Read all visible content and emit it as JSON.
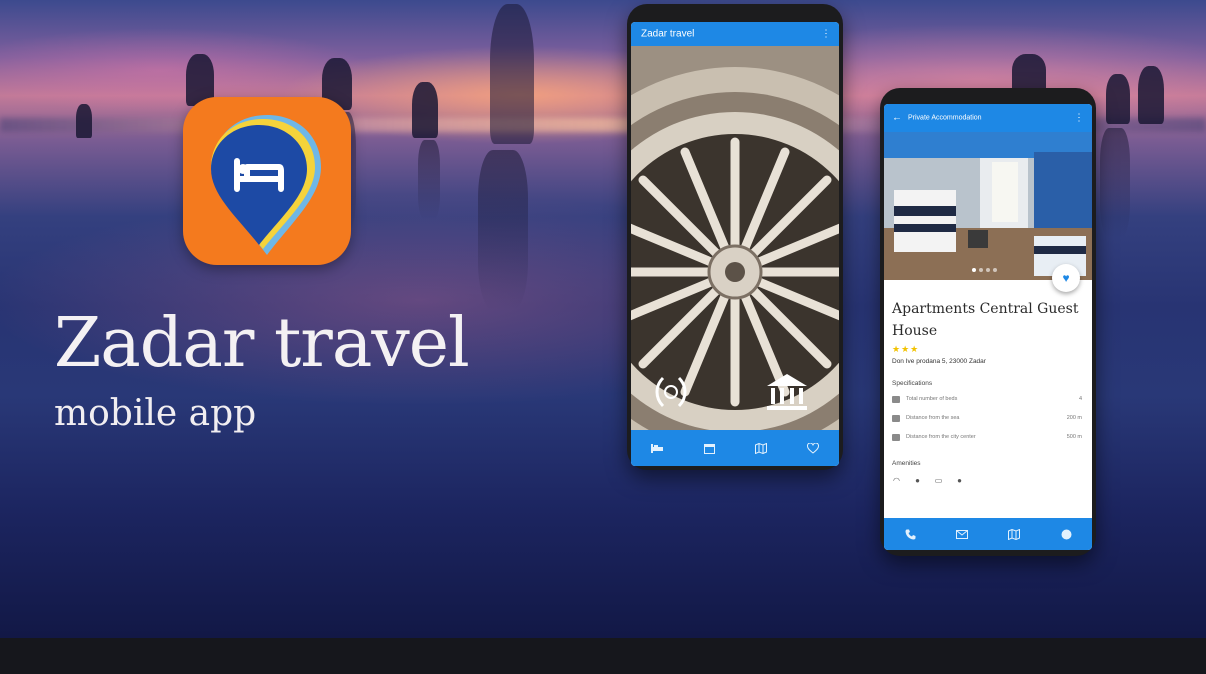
{
  "hero": {
    "title": "Zadar travel",
    "subtitle": "mobile app"
  },
  "app_icon": {
    "name": "bed-location-pin-icon",
    "background": "#f47a1e",
    "pin_colors": [
      "#1d4aa5",
      "#f5d33b",
      "#6fb7e6"
    ]
  },
  "phone1": {
    "appbar_title": "Zadar travel",
    "menu_icon": "more-vert-icon",
    "image": "rose-window-stone-carving",
    "overlay_icons": [
      "laurel-wreath-icon",
      "museum-icon"
    ],
    "nav_icons": [
      "bed-icon",
      "calendar-icon",
      "map-icon",
      "heart-icon"
    ]
  },
  "phone2": {
    "appbar_title": "Private Accommodation",
    "back_icon": "arrow-back-icon",
    "menu_icon": "more-vert-icon",
    "image": "apartment-bedroom-photo",
    "fav_icon": "heart-outline-icon",
    "hotel_name": "Apartments Central Guest House",
    "stars": "★★★",
    "rating": 3,
    "address": "Don Ive prodana 5, 23000 Zadar",
    "specs_label": "Specifications",
    "specs": [
      {
        "label": "Total number of beds",
        "value": "4"
      },
      {
        "label": "Distance from the sea",
        "value": "200 m"
      },
      {
        "label": "Distance from the city center",
        "value": "500 m"
      }
    ],
    "amenities_label": "Amenities",
    "amenity_icons": [
      "wifi-icon",
      "parking-icon",
      "tv-icon",
      "air-conditioning-icon"
    ],
    "nav_icons": [
      "phone-icon",
      "email-icon",
      "map-icon",
      "globe-icon"
    ]
  },
  "colors": {
    "app_blue": "#1e88e5",
    "bottom_band": "#16171c"
  }
}
